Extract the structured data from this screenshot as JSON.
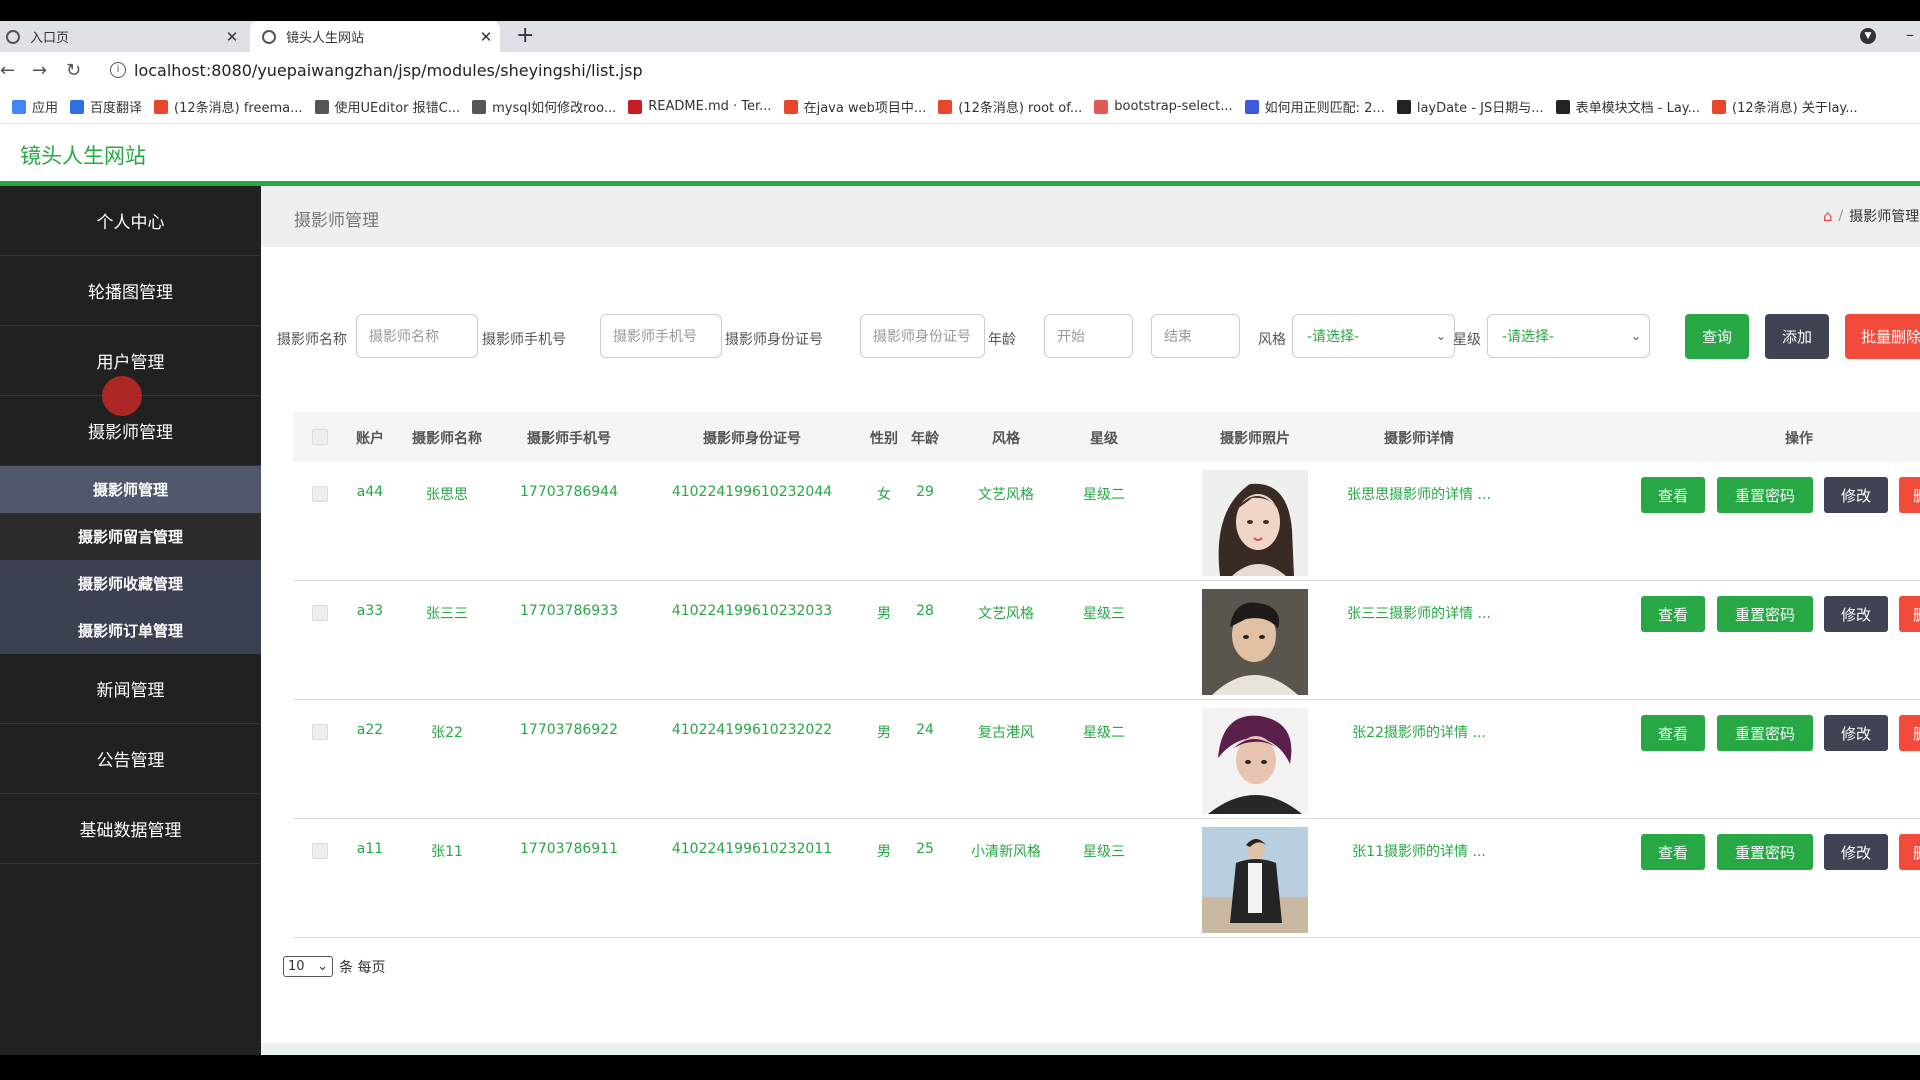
{
  "browser": {
    "tabs": [
      {
        "title": "入口页",
        "active": false
      },
      {
        "title": "镜头人生网站",
        "active": true
      }
    ],
    "url": "localhost:8080/yuepaiwangzhan/jsp/modules/sheyingshi/list.jsp",
    "bookmarks": [
      {
        "label": "应用",
        "icon_color": "#4285f4"
      },
      {
        "label": "百度翻译",
        "icon_color": "#2f6fe0"
      },
      {
        "label": "(12条消息) freema...",
        "icon_color": "#e8462b"
      },
      {
        "label": "使用UEditor 报错C...",
        "icon_color": "#555555"
      },
      {
        "label": "mysql如何修改roo...",
        "icon_color": "#555555"
      },
      {
        "label": "README.md · Ter...",
        "icon_color": "#c71d23"
      },
      {
        "label": "在java web项目中...",
        "icon_color": "#e8462b"
      },
      {
        "label": "(12条消息) root of...",
        "icon_color": "#e8462b"
      },
      {
        "label": "bootstrap-select...",
        "icon_color": "#e05a5a"
      },
      {
        "label": "如何用正则匹配: 2...",
        "icon_color": "#3b5bdb"
      },
      {
        "label": "layDate - JS日期与...",
        "icon_color": "#222222"
      },
      {
        "label": "表单模块文档 - Lay...",
        "icon_color": "#222222"
      },
      {
        "label": "(12条消息) 关于lay...",
        "icon_color": "#e8462b"
      }
    ]
  },
  "site": {
    "title": "镜头人生网站"
  },
  "sidebar": {
    "items_top": [
      "个人中心",
      "轮播图管理",
      "用户管理",
      "摄影师管理"
    ],
    "submenu": [
      {
        "label": "摄影师管理",
        "state": "active"
      },
      {
        "label": "摄影师留言管理",
        "state": "hover"
      },
      {
        "label": "摄影师收藏管理",
        "state": "normal"
      },
      {
        "label": "摄影师订单管理",
        "state": "normal"
      }
    ],
    "items_bottom": [
      "新闻管理",
      "公告管理",
      "基础数据管理"
    ]
  },
  "content": {
    "page_title": "摄影师管理",
    "breadcrumb": "摄影师管理"
  },
  "filters": {
    "name_label": "摄影师名称",
    "name_placeholder": "摄影师名称",
    "phone_label": "摄影师手机号",
    "phone_placeholder": "摄影师手机号",
    "idcard_label": "摄影师身份证号",
    "idcard_placeholder": "摄影师身份证号",
    "age_label": "年龄",
    "age_start": "开始",
    "age_end": "结束",
    "style_label": "风格",
    "style_value": "-请选择-",
    "star_label": "星级",
    "star_value": "-请选择-",
    "query_button": "查询",
    "add_button": "添加",
    "batch_delete_button": "批量删除"
  },
  "table": {
    "headers": [
      "账户",
      "摄影师名称",
      "摄影师手机号",
      "摄影师身份证号",
      "性别",
      "年龄",
      "风格",
      "星级",
      "摄影师照片",
      "摄影师详情",
      "操作"
    ],
    "rows": [
      {
        "account": "a44",
        "name": "张思思",
        "phone": "17703786944",
        "idcard": "410224199610232044",
        "gender": "女",
        "age": "29",
        "style": "文艺风格",
        "star": "星级二",
        "detail": "张思思摄影师的详情 ..."
      },
      {
        "account": "a33",
        "name": "张三三",
        "phone": "17703786933",
        "idcard": "410224199610232033",
        "gender": "男",
        "age": "28",
        "style": "文艺风格",
        "star": "星级三",
        "detail": "张三三摄影师的详情 ..."
      },
      {
        "account": "a22",
        "name": "张22",
        "phone": "17703786922",
        "idcard": "410224199610232022",
        "gender": "男",
        "age": "24",
        "style": "复古港风",
        "star": "星级二",
        "detail": "张22摄影师的详情 ..."
      },
      {
        "account": "a11",
        "name": "张11",
        "phone": "17703786911",
        "idcard": "410224199610232011",
        "gender": "男",
        "age": "25",
        "style": "小清新风格",
        "star": "星级三",
        "detail": "张11摄影师的详情 ..."
      }
    ],
    "row_actions": {
      "view": "查看",
      "reset_password": "重置密码",
      "edit": "修改",
      "delete": "删除"
    }
  },
  "pager": {
    "page_size": "10",
    "per_page_label": "条 每页"
  },
  "colors": {
    "accent": "#28a745",
    "dark": "#3f4354",
    "danger": "#f24b3c",
    "sidebar": "#212121"
  }
}
